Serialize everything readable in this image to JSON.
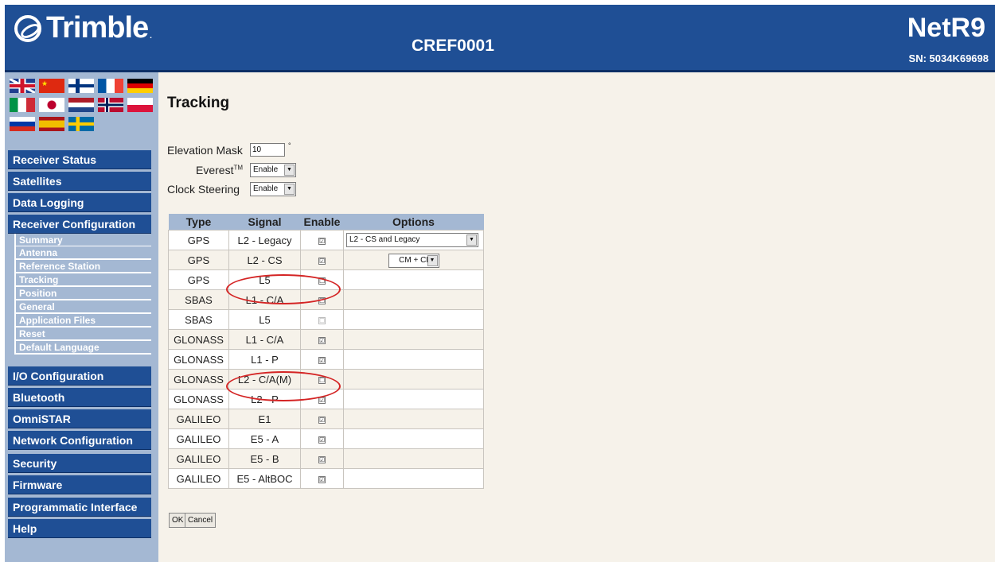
{
  "header": {
    "brand": "Trimble",
    "station": "CREF0001",
    "model": "NetR9",
    "serial": "SN: 5034K69698"
  },
  "languages": [
    {
      "icon": "uk-flag-icon",
      "colors": [
        "#1f3f8f",
        "#ffffff",
        "#cf142b"
      ]
    },
    {
      "icon": "china-flag-icon",
      "colors": [
        "#de2910",
        "#ffde00"
      ]
    },
    {
      "icon": "finland-flag-icon",
      "colors": [
        "#ffffff",
        "#003580"
      ]
    },
    {
      "icon": "france-flag-icon",
      "colors": [
        "#0055a4",
        "#ffffff",
        "#ef4135"
      ]
    },
    {
      "icon": "germany-flag-icon",
      "colors": [
        "#000000",
        "#dd0000",
        "#ffce00"
      ]
    },
    {
      "icon": "italy-flag-icon",
      "colors": [
        "#009246",
        "#ffffff",
        "#ce2b37"
      ]
    },
    {
      "icon": "japan-flag-icon",
      "colors": [
        "#ffffff",
        "#bc002d"
      ]
    },
    {
      "icon": "netherlands-flag-icon",
      "colors": [
        "#ae1c28",
        "#ffffff",
        "#21468b"
      ]
    },
    {
      "icon": "norway-flag-icon",
      "colors": [
        "#ba0c2f",
        "#ffffff",
        "#00205b"
      ]
    },
    {
      "icon": "poland-flag-icon",
      "colors": [
        "#ffffff",
        "#dc143c"
      ]
    },
    {
      "icon": "russia-flag-icon",
      "colors": [
        "#ffffff",
        "#0039a6",
        "#d52b1e"
      ]
    },
    {
      "icon": "spain-flag-icon",
      "colors": [
        "#aa151b",
        "#f1bf00"
      ]
    },
    {
      "icon": "sweden-flag-icon",
      "colors": [
        "#006aa7",
        "#fecc00"
      ]
    }
  ],
  "nav": {
    "receiver_status": "Receiver Status",
    "satellites": "Satellites",
    "data_logging": "Data Logging",
    "receiver_configuration": "Receiver Configuration",
    "sub": [
      "Summary",
      "Antenna",
      "Reference Station",
      "Tracking",
      "Position",
      "General",
      "Application Files",
      "Reset",
      "Default Language"
    ],
    "io_configuration": "I/O Configuration",
    "bluetooth": "Bluetooth",
    "omnistar": "OmniSTAR",
    "network_configuration": "Network Configuration",
    "security": "Security",
    "firmware": "Firmware",
    "programmatic_interface": "Programmatic Interface",
    "help": "Help"
  },
  "page": {
    "title": "Tracking"
  },
  "form": {
    "elevation_label": "Elevation Mask",
    "elevation_value": "10",
    "elevation_unit": "°",
    "everest_label": "Everest",
    "everest_sup": "TM",
    "everest_value": "Enable",
    "clock_label": "Clock Steering",
    "clock_value": "Enable"
  },
  "table": {
    "headers": [
      "Type",
      "Signal",
      "Enable",
      "Options"
    ],
    "rows": [
      {
        "type": "GPS",
        "signal": "L2 - Legacy",
        "enable": "☑"
      },
      {
        "type": "GPS",
        "signal": "L2 - CS",
        "enable": "☑"
      },
      {
        "type": "GPS",
        "signal": "L5",
        "enable": "☐"
      },
      {
        "type": "SBAS",
        "signal": "L1 - C/A",
        "enable": "☐"
      },
      {
        "type": "SBAS",
        "signal": "L5",
        "enable": "☐"
      },
      {
        "type": "GLONASS",
        "signal": "L1 - C/A",
        "enable": "☑"
      },
      {
        "type": "GLONASS",
        "signal": "L1 - P",
        "enable": "☑"
      },
      {
        "type": "GLONASS",
        "signal": "L2 - C/A(M)",
        "enable": "☐"
      },
      {
        "type": "GLONASS",
        "signal": "L2 - P",
        "enable": "☑"
      },
      {
        "type": "GALILEO",
        "signal": "E1",
        "enable": "☑"
      },
      {
        "type": "GALILEO",
        "signal": "E5 - A",
        "enable": "☑"
      },
      {
        "type": "GALILEO",
        "signal": "E5 - B",
        "enable": "☑"
      },
      {
        "type": "GALILEO",
        "signal": "E5 - AltBOC",
        "enable": "☑"
      }
    ],
    "option_l2_legacy": "L2 - CS and Legacy",
    "option_l2_cs": "CM + CL"
  },
  "buttons": {
    "ok": "OK",
    "cancel": "Cancel"
  },
  "colors": {
    "header_blue": "#1f4f95",
    "sidebar_blue": "#a4b8d3",
    "annotation_red": "#d42424"
  }
}
